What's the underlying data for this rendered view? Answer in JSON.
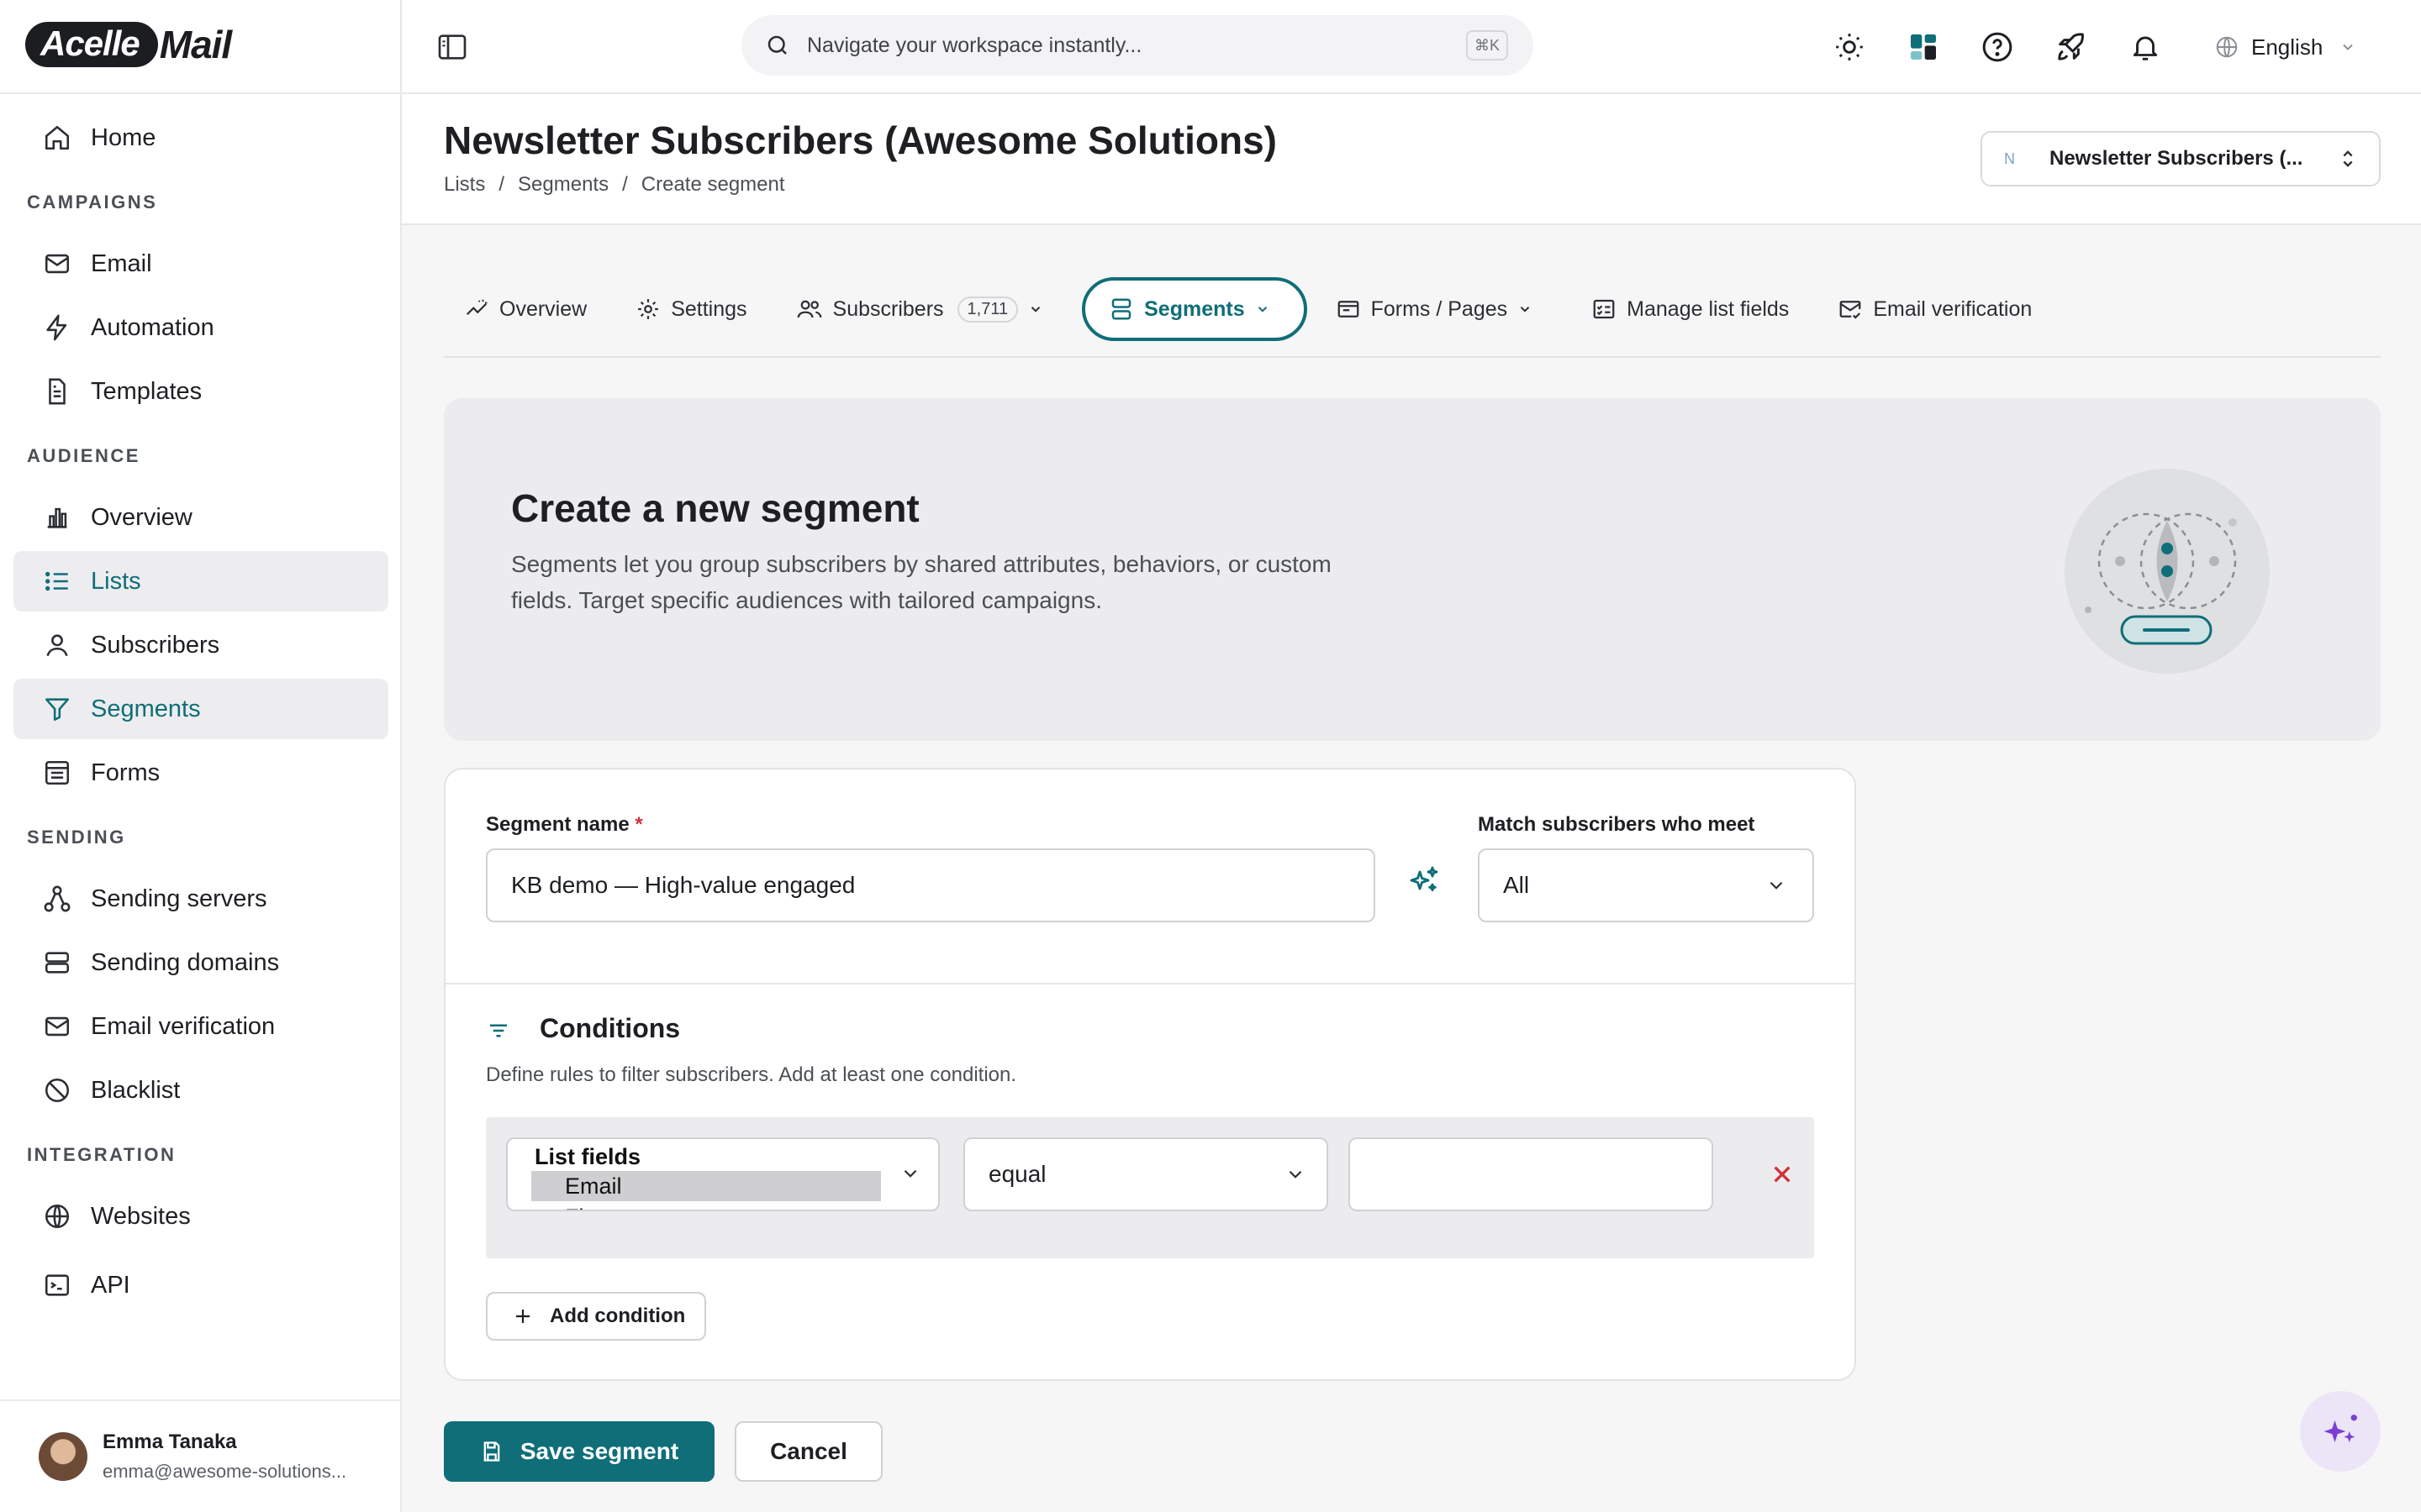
{
  "brand": {
    "logo_left": "Acelle",
    "logo_right": "Mail",
    "accent": "#0f6e78"
  },
  "sidebar": {
    "items": [
      {
        "label": "Home"
      },
      {
        "section": "CAMPAIGNS"
      },
      {
        "label": "Email"
      },
      {
        "label": "Automation"
      },
      {
        "label": "Templates"
      },
      {
        "section": "AUDIENCE"
      },
      {
        "label": "Overview"
      },
      {
        "label": "Lists"
      },
      {
        "label": "Subscribers"
      },
      {
        "label": "Segments"
      },
      {
        "label": "Forms"
      },
      {
        "section": "SENDING"
      },
      {
        "label": "Sending servers"
      },
      {
        "label": "Sending domains"
      },
      {
        "label": "Email verification"
      },
      {
        "label": "Blacklist"
      },
      {
        "section": "INTEGRATION"
      },
      {
        "label": "Websites"
      },
      {
        "label": "API"
      }
    ],
    "user": {
      "name": "Emma Tanaka",
      "email": "emma@awesome-solutions..."
    }
  },
  "topbar": {
    "search_placeholder": "Navigate your workspace instantly...",
    "shortcut": "⌘K",
    "language": "English"
  },
  "header": {
    "title": "Newsletter Subscribers (Awesome Solutions)",
    "breadcrumb": [
      "Lists",
      "/",
      "Segments",
      "/",
      "Create segment"
    ],
    "list_selector": {
      "badge": "N",
      "label": "Newsletter Subscribers (..."
    }
  },
  "tabs": [
    {
      "label": "Overview"
    },
    {
      "label": "Settings"
    },
    {
      "label": "Subscribers",
      "count": "1,711"
    },
    {
      "label": "Segments"
    },
    {
      "label": "Forms / Pages"
    },
    {
      "label": "Manage list fields"
    },
    {
      "label": "Email verification"
    }
  ],
  "hero": {
    "title": "Create a new segment",
    "description": "Segments let you group subscribers by shared attributes, behaviors, or custom fields. Target specific audiences with tailored campaigns."
  },
  "form": {
    "segment_name_label": "Segment name",
    "required_mark": "*",
    "segment_name_value": "KB demo — High-value engaged",
    "match_label": "Match subscribers who meet",
    "match_value": "All",
    "conditions_title": "Conditions",
    "conditions_desc": "Define rules to filter subscribers. Add at least one condition.",
    "condition": {
      "field_group": "List fields",
      "field_selected": "Email",
      "field_next": "First name",
      "operator": "equal",
      "value": ""
    },
    "add_condition": "Add condition"
  },
  "actions": {
    "save": "Save segment",
    "cancel": "Cancel"
  }
}
